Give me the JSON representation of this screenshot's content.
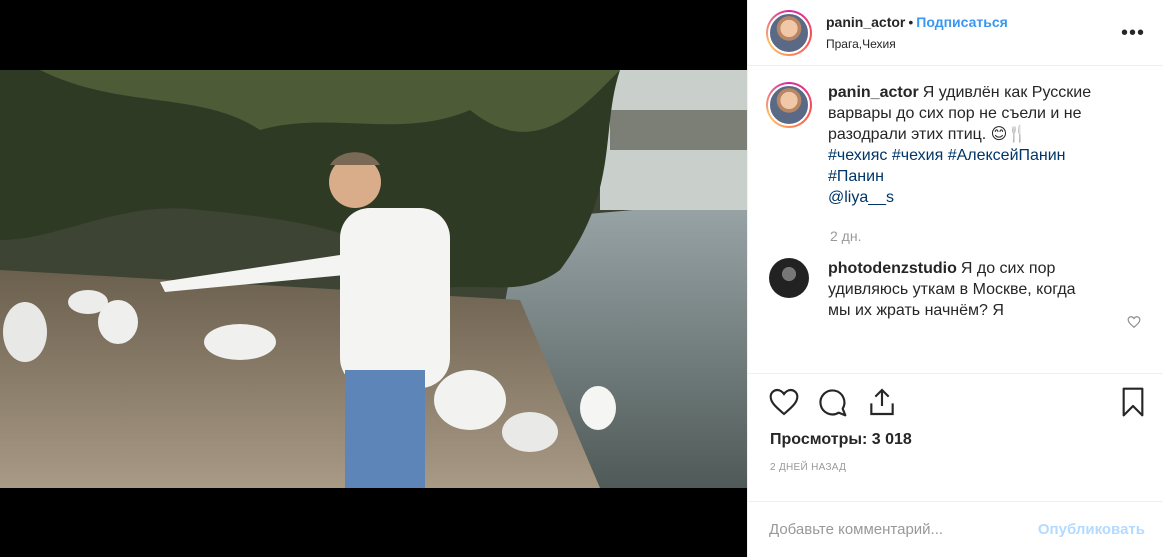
{
  "header": {
    "username": "panin_actor",
    "separator": "•",
    "follow_label": "Подписаться",
    "location": "Прага,Чехия",
    "more_label": "•••"
  },
  "caption": {
    "username": "panin_actor",
    "text": "Я удивлён как Русские варвары до сих пор не съели и не разодрали этих птиц. 😊🍴",
    "hashtags": [
      "#чехияс",
      "#чехия",
      "#АлексейПанин",
      "#Панин"
    ],
    "mention": "@liya__s",
    "time": "2 дн."
  },
  "comments": [
    {
      "username": "photodenzstudio",
      "text": "Я до сих пор удивляюсь уткам в Москве, когда мы их жрать начнём? Я"
    }
  ],
  "stats": {
    "views_label": "Просмотры: 3 018",
    "date": "2 ДНЕЙ НАЗАД"
  },
  "add_comment": {
    "placeholder": "Добавьте комментарий...",
    "post_label": "Опубликовать"
  },
  "colors": {
    "link_blue": "#3897f0",
    "hashtag_blue": "#003569",
    "post_disabled": "#b3dbff"
  }
}
